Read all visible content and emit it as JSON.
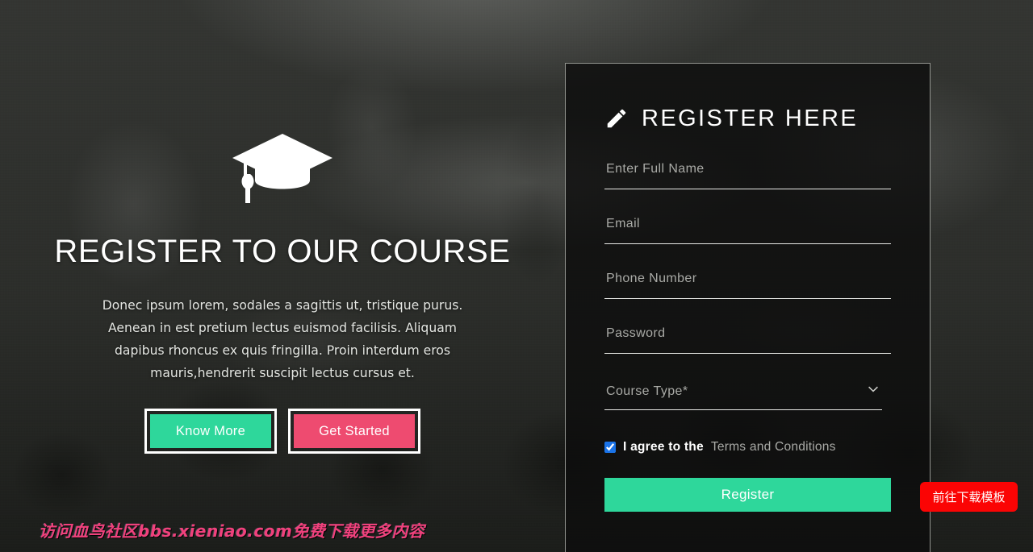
{
  "hero": {
    "icon": "graduation-cap-icon",
    "title": "REGISTER TO OUR COURSE",
    "paragraph": "Donec ipsum lorem, sodales a sagittis ut, tristique purus. Aenean in est pretium lectus euismod facilisis. Aliquam dapibus rhoncus ex quis fringilla. Proin interdum eros mauris,hendrerit suscipit lectus cursus et.",
    "buttons": [
      {
        "label": "Know More",
        "color": "#2ed79b"
      },
      {
        "label": "Get Started",
        "color": "#ee4b70"
      }
    ]
  },
  "register": {
    "icon": "pencil-icon",
    "title": "REGISTER  HERE",
    "fields": [
      {
        "name": "full-name",
        "placeholder": "Enter Full Name",
        "value": "",
        "type": "text"
      },
      {
        "name": "email",
        "placeholder": "Email",
        "value": "",
        "type": "email"
      },
      {
        "name": "phone",
        "placeholder": "Phone Number",
        "value": "",
        "type": "tel"
      },
      {
        "name": "password",
        "placeholder": "Password",
        "value": "",
        "type": "password"
      }
    ],
    "course_select": {
      "selected": "Course Type*",
      "options": [
        "Course Type*"
      ],
      "chevron": "chevron-down-icon"
    },
    "agree": {
      "checked": true,
      "text": "I agree to the",
      "link": "Terms and Conditions",
      "checkbox_color": "#1a73e8"
    },
    "submit_label": "Register",
    "submit_color": "#2ed79b"
  },
  "overlay": {
    "watermark": "访问血鸟社区bbs.xieniao.com免费下载更多内容",
    "watermark_color": "#f0417c",
    "download_badge": "前往下载模板",
    "download_badge_color": "#fb0404"
  }
}
